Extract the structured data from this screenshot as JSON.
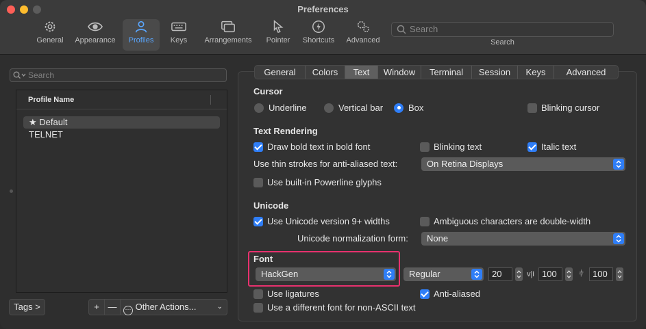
{
  "window": {
    "title": "Preferences"
  },
  "toolbar": {
    "items": [
      {
        "label": "General",
        "icon": "gear-icon"
      },
      {
        "label": "Appearance",
        "icon": "eye-icon"
      },
      {
        "label": "Profiles",
        "icon": "person-icon"
      },
      {
        "label": "Keys",
        "icon": "keyboard-icon"
      },
      {
        "label": "Arrangements",
        "icon": "windows-icon"
      },
      {
        "label": "Pointer",
        "icon": "pointer-icon"
      },
      {
        "label": "Shortcuts",
        "icon": "bolt-icon"
      },
      {
        "label": "Advanced",
        "icon": "gears-icon"
      }
    ],
    "active": "Profiles",
    "search_placeholder": "Search",
    "search_caption": "Search"
  },
  "left": {
    "search_placeholder": "Search",
    "column_header": "Profile Name",
    "profiles": [
      "★ Default",
      "TELNET"
    ],
    "tags_button": "Tags >",
    "add_button": "+",
    "remove_button": "—",
    "other_actions": "Other Actions..."
  },
  "tabs": [
    "General",
    "Colors",
    "Text",
    "Window",
    "Terminal",
    "Session",
    "Keys",
    "Advanced"
  ],
  "active_tab": "Text",
  "cursor": {
    "title": "Cursor",
    "underline": "Underline",
    "vertical_bar": "Vertical bar",
    "box": "Box",
    "selected": "Box",
    "blinking": "Blinking cursor"
  },
  "text_rendering": {
    "title": "Text Rendering",
    "bold": "Draw bold text in bold font",
    "blinking_text": "Blinking text",
    "italic": "Italic text",
    "thin_strokes_label": "Use thin strokes for anti-aliased text:",
    "thin_strokes_value": "On Retina Displays",
    "powerline": "Use built-in Powerline glyphs"
  },
  "unicode": {
    "title": "Unicode",
    "version9": "Use Unicode version 9+ widths",
    "ambiguous": "Ambiguous characters are double-width",
    "normalization_label": "Unicode normalization form:",
    "normalization_value": "None"
  },
  "font": {
    "title": "Font",
    "family": "HackGen",
    "style": "Regular",
    "size": "20",
    "vertical_spacing": "100",
    "horizontal_spacing": "100",
    "ligatures": "Use ligatures",
    "anti_aliased": "Anti-aliased",
    "non_ascii": "Use a different font for non-ASCII text"
  },
  "colors": {
    "accent": "#2f7ef7",
    "highlight": "#e8316e"
  }
}
